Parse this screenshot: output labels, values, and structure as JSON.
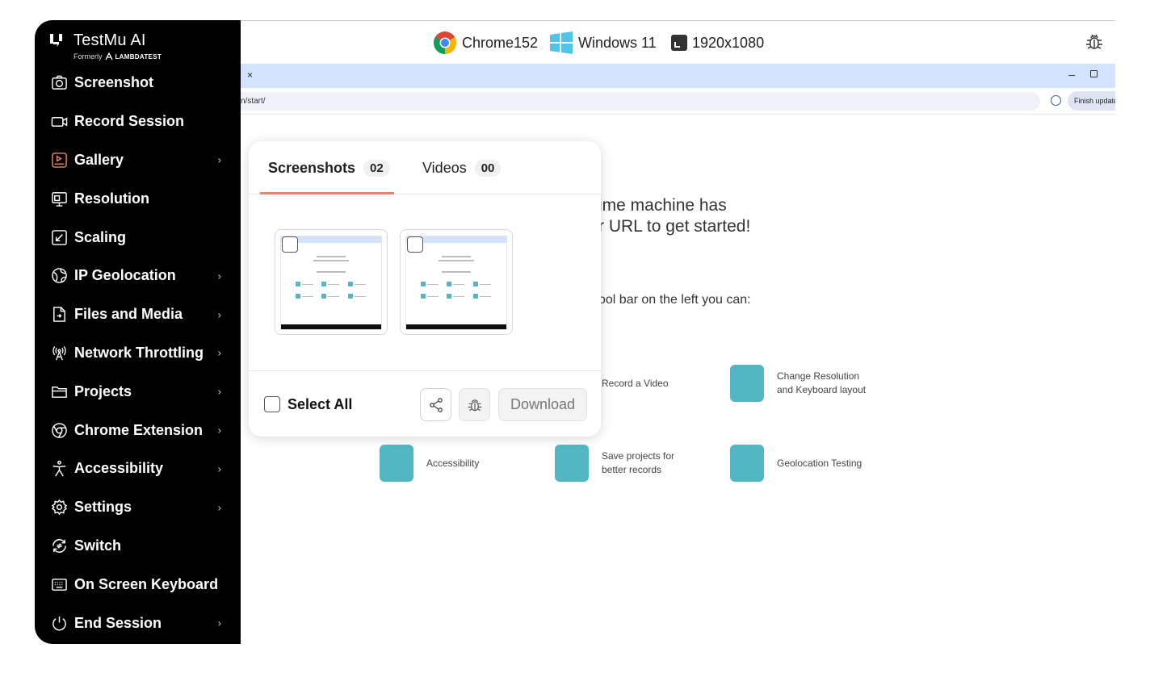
{
  "brand": {
    "name": "TestMu AI",
    "formerly": "Formerly",
    "former_name": "LAMBDATEST"
  },
  "menu": [
    {
      "label": "Screenshot",
      "icon": "camera-icon",
      "chevron": false
    },
    {
      "label": "Record Session",
      "icon": "video-camera-icon",
      "chevron": false
    },
    {
      "label": "Gallery",
      "icon": "gallery-icon",
      "chevron": true
    },
    {
      "label": "Resolution",
      "icon": "monitor-icon",
      "chevron": false
    },
    {
      "label": "Scaling",
      "icon": "scaling-icon",
      "chevron": false
    },
    {
      "label": "IP Geolocation",
      "icon": "globe-icon",
      "chevron": true
    },
    {
      "label": "Files and Media",
      "icon": "file-icon",
      "chevron": true
    },
    {
      "label": "Network Throttling",
      "icon": "antenna-icon",
      "chevron": true
    },
    {
      "label": "Projects",
      "icon": "folder-icon",
      "chevron": true
    },
    {
      "label": "Chrome Extension",
      "icon": "chrome-icon",
      "chevron": true
    },
    {
      "label": "Accessibility",
      "icon": "accessibility-icon",
      "chevron": true
    },
    {
      "label": "Settings",
      "icon": "gear-icon",
      "chevron": true
    },
    {
      "label": "Switch",
      "icon": "switch-icon",
      "chevron": false
    },
    {
      "label": "On Screen Keyboard",
      "icon": "keyboard-icon",
      "chevron": false
    },
    {
      "label": "End Session",
      "icon": "power-icon",
      "chevron": true
    }
  ],
  "chevron_glyph": "›",
  "topbar": {
    "browser": "Chrome152",
    "os": "Windows 11",
    "resolution": "1920x1080"
  },
  "browser": {
    "tab_close": "×",
    "minimize": "–",
    "url": "n/start/",
    "finish_update": "Finish update"
  },
  "page": {
    "hero_line1": "ime machine has",
    "hero_line2": "r URL to get started!",
    "hint": "ool bar on the left you can:",
    "features": [
      {
        "text1": "Record a Video",
        "text2": ""
      },
      {
        "text1": "Change Resolution",
        "text2": "and Keyboard layout"
      },
      {
        "text1": "Accessibility",
        "text2": ""
      },
      {
        "text1": "Save projects for",
        "text2": "better records"
      },
      {
        "text1": "Geolocation Testing",
        "text2": ""
      }
    ]
  },
  "gallery": {
    "tabs": [
      {
        "label": "Screenshots",
        "count": "02",
        "active": true
      },
      {
        "label": "Videos",
        "count": "00",
        "active": false
      }
    ],
    "select_all": "Select All",
    "download": "Download"
  },
  "colors": {
    "accent": "#e98565",
    "teal": "#52b7c3",
    "sidebar": "#000000",
    "tabstrip": "#d3e3fd"
  }
}
